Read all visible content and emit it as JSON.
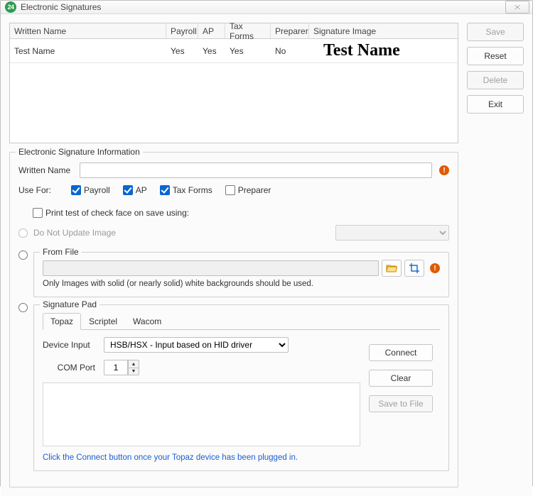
{
  "window": {
    "title": "Electronic Signatures",
    "app_icon_label": "24"
  },
  "grid": {
    "columns": {
      "name": "Written Name",
      "payroll": "Payroll",
      "ap": "AP",
      "tax": "Tax Forms",
      "preparer": "Preparer",
      "sigimg": "Signature Image"
    },
    "rows": [
      {
        "name": "Test Name",
        "payroll": "Yes",
        "ap": "Yes",
        "tax": "Yes",
        "preparer": "No",
        "sig": "Test Name"
      }
    ]
  },
  "side": {
    "save": "Save",
    "reset": "Reset",
    "delete": "Delete",
    "exit": "Exit"
  },
  "info": {
    "group_title": "Electronic Signature Information",
    "written_name_label": "Written Name",
    "written_name_value": "",
    "usefor_label": "Use For:",
    "payroll": "Payroll",
    "ap": "AP",
    "taxforms": "Tax Forms",
    "preparer": "Preparer",
    "print_test": "Print test of check face on save using:",
    "no_update": "Do Not Update Image",
    "from_file": {
      "title": "From File",
      "path": "",
      "note": "Only Images with solid (or nearly solid) white backgrounds should be used."
    },
    "sigpad": {
      "title": "Signature Pad",
      "tabs": {
        "topaz": "Topaz",
        "scriptel": "Scriptel",
        "wacom": "Wacom"
      },
      "device_input_label": "Device Input",
      "device_input_value": "HSB/HSX - Input based on HID driver",
      "com_port_label": "COM Port",
      "com_port_value": "1",
      "connect": "Connect",
      "clear": "Clear",
      "savefile": "Save to File",
      "hint": "Click the Connect button once your Topaz device has been plugged in."
    }
  }
}
